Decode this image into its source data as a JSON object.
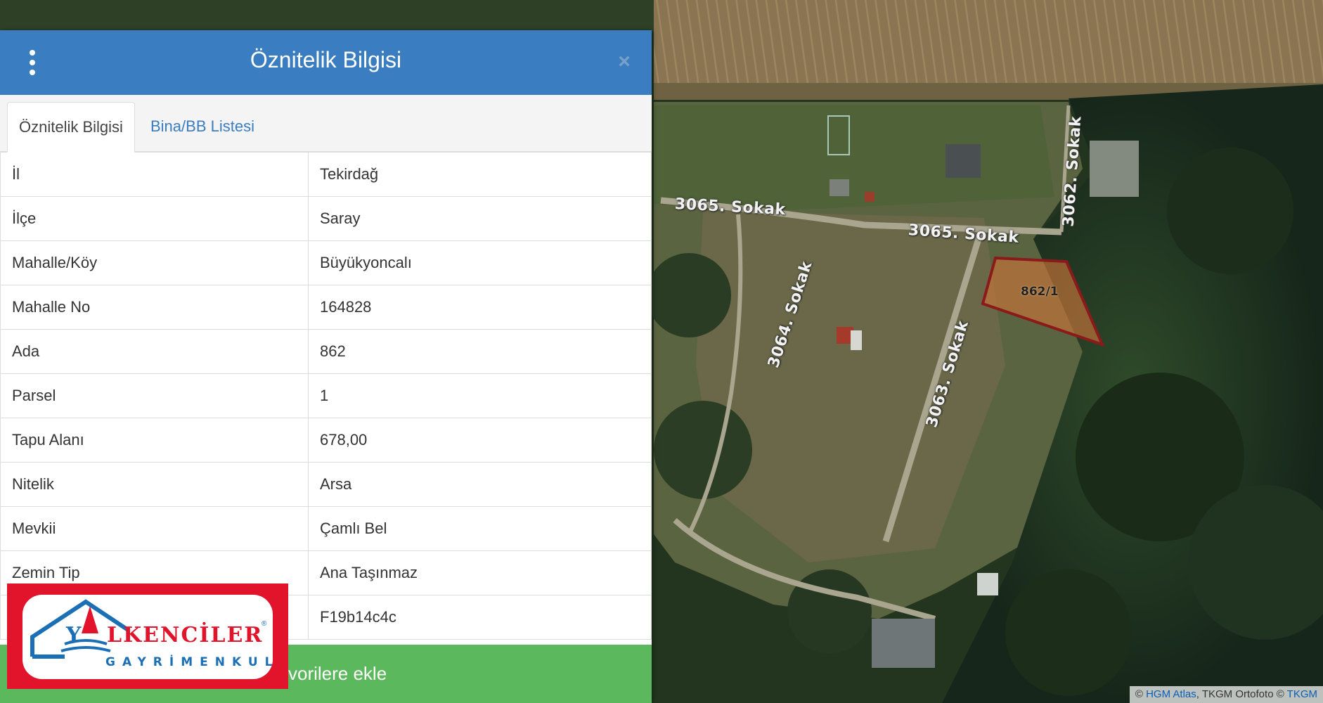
{
  "map": {
    "road_labels": [
      "3065. Sokak",
      "3065. Sokak",
      "3062. Sokak",
      "3064. Sokak",
      "3063. Sokak"
    ],
    "parcel_label": "862/1",
    "attribution": {
      "prefix": "© ",
      "link1": "HGM Atlas",
      "middle": ", TKGM Ortofoto © ",
      "link2": "TKGM"
    }
  },
  "panel": {
    "title": "Öznitelik Bilgisi",
    "menu_icon": "vertical-dots-icon",
    "close_icon": "close-icon",
    "close_glyph": "×",
    "tabs": [
      {
        "label": "Öznitelik Bilgisi",
        "active": true
      },
      {
        "label": "Bina/BB Listesi",
        "active": false
      }
    ],
    "rows": [
      {
        "key": "İl",
        "value": "Tekirdağ"
      },
      {
        "key": "İlçe",
        "value": "Saray"
      },
      {
        "key": "Mahalle/Köy",
        "value": "Büyükyoncalı"
      },
      {
        "key": "Mahalle No",
        "value": "164828"
      },
      {
        "key": "Ada",
        "value": "862"
      },
      {
        "key": "Parsel",
        "value": "1"
      },
      {
        "key": "Tapu Alanı",
        "value": "678,00"
      },
      {
        "key": "Nitelik",
        "value": "Arsa"
      },
      {
        "key": "Mevkii",
        "value": "Çamlı Bel"
      },
      {
        "key": "Zemin Tip",
        "value": "Ana Taşınmaz"
      },
      {
        "key": "",
        "value": "F19b14c4c"
      }
    ],
    "favorite_label": "vorilere ekle"
  },
  "logo": {
    "first_letter": "Y",
    "word": "LKENCİLER",
    "registered": "®",
    "subtitle": "GAYRİMENKUL"
  },
  "colors": {
    "header_blue": "#3a7dc0",
    "fav_green": "#5cb85c",
    "logo_red": "#e2142c",
    "logo_blue": "#1b6fb4",
    "parcel_fill": "#c9743a",
    "parcel_stroke": "#8b1a1a"
  }
}
